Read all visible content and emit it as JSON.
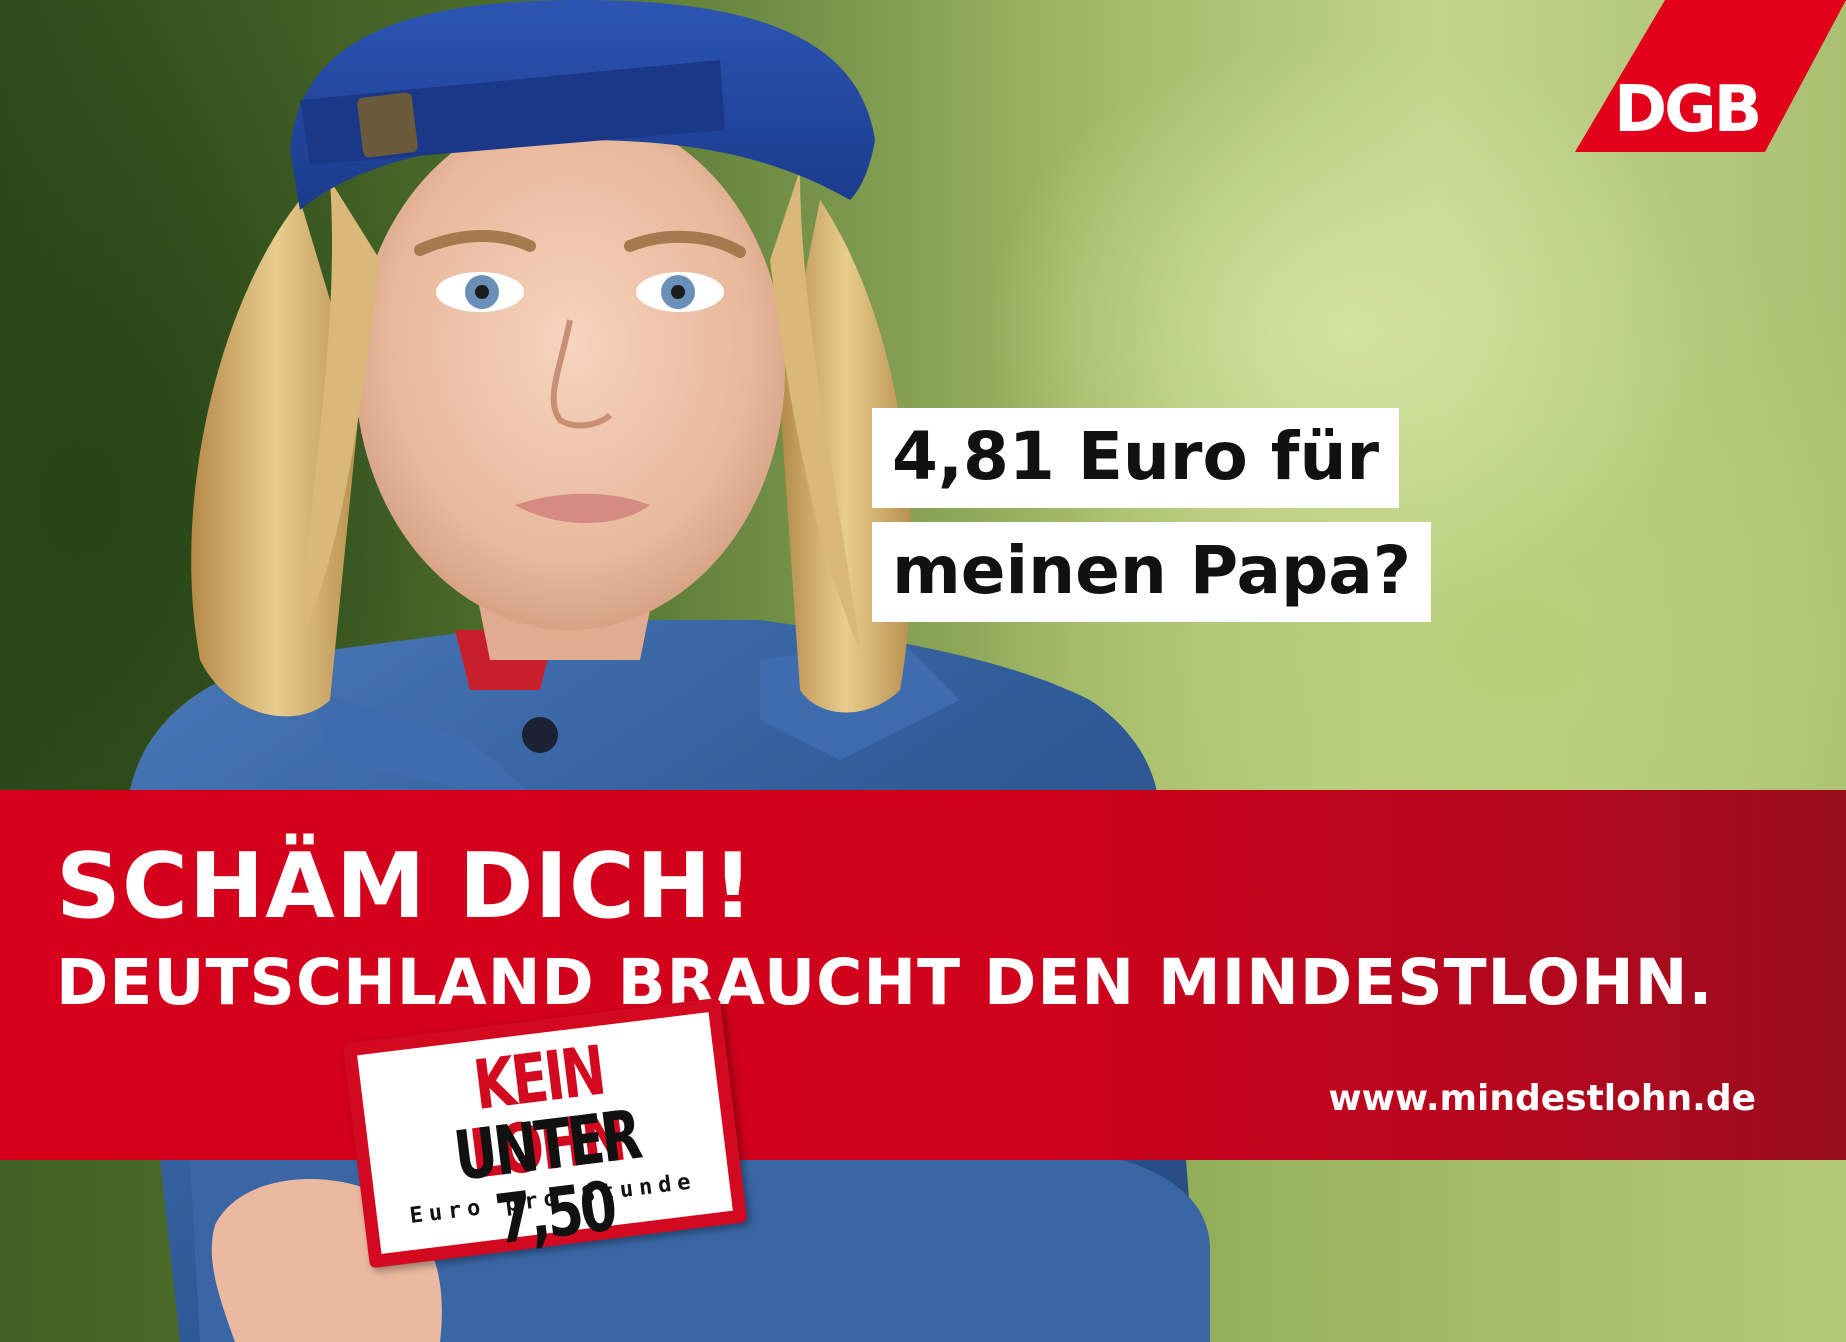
{
  "quote": {
    "line1": "4,81 Euro für",
    "line2": "meinen Papa?"
  },
  "headline": {
    "line1": "SCHÄM DICH!",
    "line2": "DEUTSCHLAND BRAUCHT DEN MINDESTLOHN."
  },
  "url": "www.mindestlohn.de",
  "logo": {
    "text": "DGB",
    "color": "#e3001b"
  },
  "badge": {
    "line1": "KEIN LOHN",
    "line2": "UNTER 7,50",
    "line3": "Euro pro Stunde",
    "color": "#d30a1f"
  },
  "colors": {
    "banner_red": "#d6001c",
    "text_white": "#ffffff",
    "cap_blue": "#1f3f9e",
    "jacket_blue": "#3b66a8"
  }
}
